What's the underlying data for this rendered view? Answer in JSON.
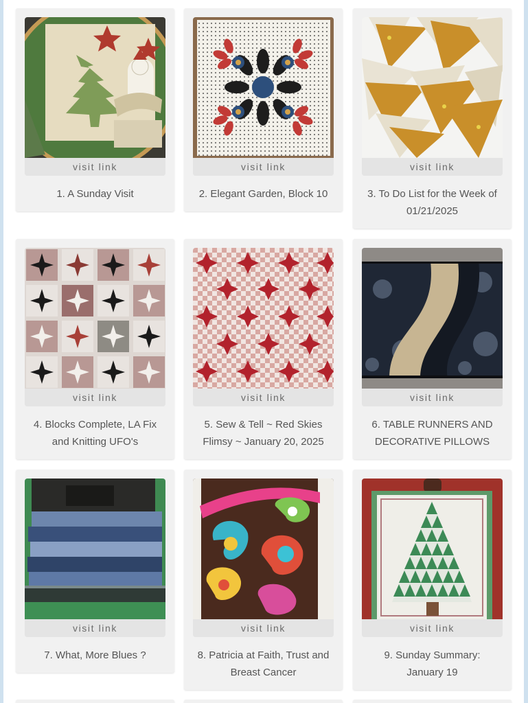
{
  "links": [
    {
      "title": "1. A Sunday Visit",
      "visit": "visit link",
      "thumb": "quilted-christmas-tree-hoop-image"
    },
    {
      "title": "2. Elegant Garden, Block 10",
      "visit": "visit link",
      "thumb": "applique-flower-block-image"
    },
    {
      "title": "3. To Do List for the Week of 01/21/2025",
      "visit": "visit link",
      "thumb": "gold-triangle-pieces-image"
    },
    {
      "title": "4. Blocks Complete, LA Fix and Knitting UFO's",
      "visit": "visit link",
      "thumb": "black-white-star-blocks-image"
    },
    {
      "title": "5. Sew & Tell ~ Red Skies Flimsy ~ January 20, 2025",
      "visit": "visit link",
      "thumb": "red-star-quilt-image"
    },
    {
      "title": "6. TABLE RUNNERS AND DECORATIVE PILLOWS",
      "visit": "visit link",
      "thumb": "curved-table-runner-image"
    },
    {
      "title": "7. What, More Blues ?",
      "visit": "visit link",
      "thumb": "blue-strips-sewing-machine-image"
    },
    {
      "title": "8. Patricia at Faith, Trust and Breast Cancer",
      "visit": "visit link",
      "thumb": "paisley-fabric-bag-image"
    },
    {
      "title": "9. Sunday Summary: January 19",
      "visit": "visit link",
      "thumb": "triangle-tree-wallhanging-image"
    }
  ],
  "colors": {
    "card_bg": "#f1f1f1",
    "visit_bar": "#e4e4e4",
    "text": "#555555",
    "frame": "#cfe1ef"
  }
}
